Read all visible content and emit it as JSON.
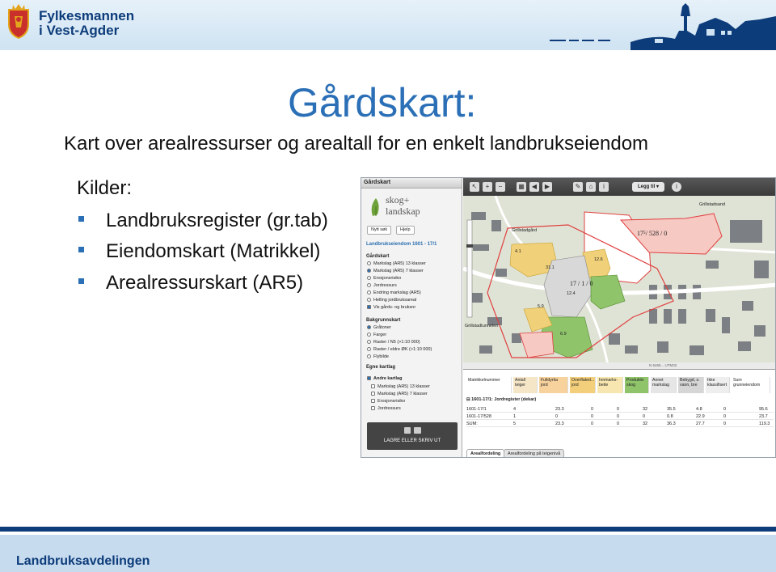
{
  "header": {
    "org_line1": "Fylkesmannen",
    "org_line2": "i Vest-Agder",
    "brand_color": "#0d3c7a",
    "crest_icon": "coat-of-arms-icon",
    "skyline_icon": "lighthouse-village-silhouette-icon"
  },
  "slide": {
    "title": "Gårdskart:",
    "subtitle": "Kart over arealressurser og arealtall for en enkelt landbrukseiendom",
    "sources_label": "Kilder:",
    "bullets": [
      "Landbruksregister (gr.tab)",
      "Eiendomskart (Matrikkel)",
      "Arealressurskart (AR5)"
    ],
    "title_color": "#2b6fb6"
  },
  "app": {
    "panel_title": "Gårdskart",
    "logo_text_1": "skog+",
    "logo_text_2": "landskap",
    "btn_new_search": "Nytt søk",
    "btn_help": "Hjelp",
    "property_heading": "Landbrukseiendom 1601 - 17/1",
    "gardskart_section": "Gårdskart",
    "gardskart_options": [
      "Markslag (AR5) 13 klasser",
      "Markslag (AR5) 7 klasser",
      "Erosjonsrisiko",
      "Jordressurs",
      "Endring markslag (AR5)",
      "Helling jordbruksareal",
      "Vis gårds- og bruksnr"
    ],
    "bakgrunn_section": "Bakgrunnskart",
    "bakgrunn_options": [
      "Gråtoner",
      "Farger",
      "Raster / N5 (>1:10 000)",
      "Raster / eldre ØK (>1:10 000)",
      "Flybilde"
    ],
    "egne_kartlag": "Egne kartlag",
    "andre_kartlag": "Andre kartlag",
    "andre_options": [
      "Markslag (AR5) 13 klasser",
      "Markslag (AR5) 7 klasser",
      "Erosjonsrisiko",
      "Jordressurs"
    ],
    "lagre_button": "LAGRE ELLER SKRIV UT",
    "toolbar_add_layer": "Legg til",
    "map_labels": {
      "street1": "Grillstadgård",
      "street2": "Grillstadtunnelen",
      "street3": "Grillstadsand",
      "street4": "Grillstadtunnelen",
      "parcel_main": "17 / 1 / 0",
      "parcel_other": "17⁵/ 528 / 0",
      "area_41": "4.1",
      "area_311": "31.1",
      "area_126": "12.6",
      "area_124": "12.4",
      "area_59": "5.9",
      "area_69": "6.9"
    },
    "table_headers": [
      "Matrikkelnummer",
      "Antall teiger",
      "Fulldyrka jord",
      "Overflated... jord",
      "Innmarks-beite",
      "Produktiv skog",
      "Annet markslag",
      "Bebygd, s. vann, bre",
      "Ikke klassifisert",
      "Sum grunneiendom"
    ],
    "table_group": "1601-17/1: Jordregister (dekar)",
    "table_rows": [
      [
        "1601-17/1",
        "4",
        "23.3",
        "0",
        "0",
        "32",
        "35.5",
        "4.8",
        "0",
        "95.6"
      ],
      [
        "1601-17/528",
        "1",
        "0",
        "0",
        "0",
        "0",
        "0.8",
        "22.9",
        "0",
        "23.7"
      ],
      [
        "SUM:",
        "5",
        "23.3",
        "0",
        "0",
        "32",
        "36.3",
        "27.7",
        "0",
        "119.3"
      ]
    ],
    "tabs": [
      "Arealfordeling",
      "Arealfordeling på teigenivå"
    ],
    "map_footer": "N 6465...  UTM32"
  },
  "footer": {
    "text": "Landbruksavdelingen"
  }
}
